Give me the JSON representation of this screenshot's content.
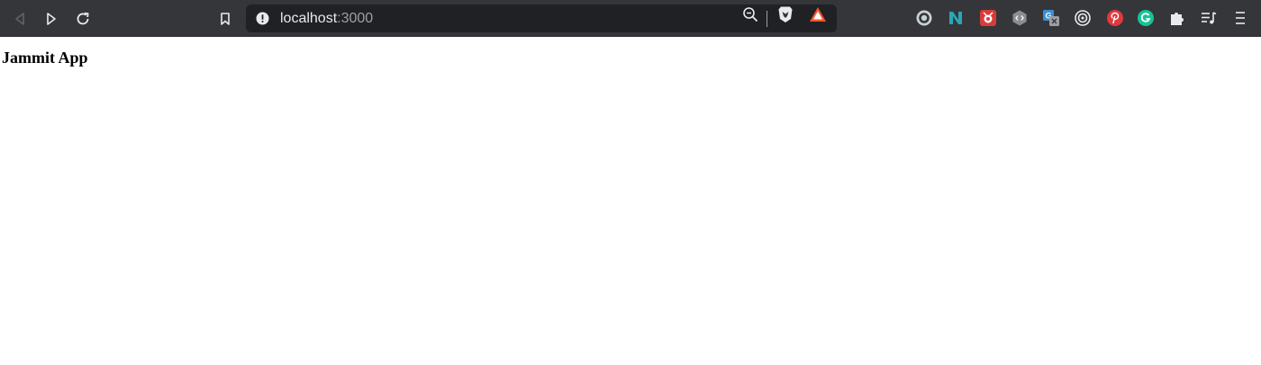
{
  "browser": {
    "address_bar": {
      "host": "localhost",
      "port": ":3000"
    },
    "nav_buttons": [
      "back",
      "forward",
      "reload"
    ],
    "extensions": [
      "ext-o-circle",
      "ext-n-logo",
      "ext-red-bug",
      "ext-code-hex",
      "ext-translate",
      "ext-target",
      "ext-pinterest",
      "ext-grammarly",
      "extensions-puzzle",
      "media-queue",
      "browser-menu"
    ]
  },
  "page": {
    "heading": "Jammit App"
  },
  "colors": {
    "toolbar_bg": "#35363a",
    "omnibox_bg": "#202124",
    "url_host": "#e8eaed",
    "url_port": "#9aa0a6",
    "page_bg": "#ffffff"
  }
}
